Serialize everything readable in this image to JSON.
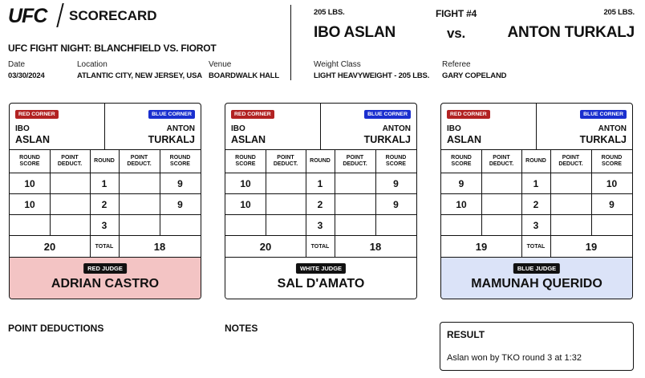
{
  "header": {
    "brand": "UFC",
    "doc_title": "SCORECARD",
    "event": "UFC FIGHT NIGHT: BLANCHFIELD VS. FIOROT",
    "date_label": "Date",
    "date": "03/30/2024",
    "location_label": "Location",
    "location": "ATLANTIC CITY, NEW JERSEY, USA",
    "venue_label": "Venue",
    "venue": "BOARDWALK HALL"
  },
  "fight": {
    "fight_number": "FIGHT #4",
    "vs": "vs.",
    "red_fighter": {
      "weight": "205 LBS.",
      "name": "IBO ASLAN"
    },
    "blue_fighter": {
      "weight": "205 LBS.",
      "name": "ANTON TURKALJ"
    },
    "weight_class_label": "Weight Class",
    "weight_class": "LIGHT HEAVYWEIGHT - 205 LBS.",
    "referee_label": "Referee",
    "referee": "GARY COPELAND"
  },
  "labels": {
    "red_corner": "RED CORNER",
    "blue_corner": "BLUE CORNER",
    "round_score": "ROUND SCORE",
    "point_deduct": "POINT DEDUCT.",
    "round": "ROUND",
    "total": "TOTAL",
    "point_deductions_section": "POINT DEDUCTIONS",
    "notes_section": "NOTES",
    "result_section": "RESULT"
  },
  "cards": [
    {
      "red_first": "IBO",
      "red_last": "ASLAN",
      "blue_first": "ANTON",
      "blue_last": "TURKALJ",
      "rounds": [
        {
          "round": "1",
          "red_score": "10",
          "red_deduct": "",
          "blue_deduct": "",
          "blue_score": "9"
        },
        {
          "round": "2",
          "red_score": "10",
          "red_deduct": "",
          "blue_deduct": "",
          "blue_score": "9"
        },
        {
          "round": "3",
          "red_score": "",
          "red_deduct": "",
          "blue_deduct": "",
          "blue_score": ""
        }
      ],
      "red_total": "20",
      "blue_total": "18",
      "judge_label": "RED JUDGE",
      "judge_name": "ADRIAN CASTRO",
      "judge_bg": "#f3c4c4"
    },
    {
      "red_first": "IBO",
      "red_last": "ASLAN",
      "blue_first": "ANTON",
      "blue_last": "TURKALJ",
      "rounds": [
        {
          "round": "1",
          "red_score": "10",
          "red_deduct": "",
          "blue_deduct": "",
          "blue_score": "9"
        },
        {
          "round": "2",
          "red_score": "10",
          "red_deduct": "",
          "blue_deduct": "",
          "blue_score": "9"
        },
        {
          "round": "3",
          "red_score": "",
          "red_deduct": "",
          "blue_deduct": "",
          "blue_score": ""
        }
      ],
      "red_total": "20",
      "blue_total": "18",
      "judge_label": "WHITE JUDGE",
      "judge_name": "SAL D'AMATO",
      "judge_bg": "#ffffff"
    },
    {
      "red_first": "IBO",
      "red_last": "ASLAN",
      "blue_first": "ANTON",
      "blue_last": "TURKALJ",
      "rounds": [
        {
          "round": "1",
          "red_score": "9",
          "red_deduct": "",
          "blue_deduct": "",
          "blue_score": "10"
        },
        {
          "round": "2",
          "red_score": "10",
          "red_deduct": "",
          "blue_deduct": "",
          "blue_score": "9"
        },
        {
          "round": "3",
          "red_score": "",
          "red_deduct": "",
          "blue_deduct": "",
          "blue_score": ""
        }
      ],
      "red_total": "19",
      "blue_total": "19",
      "judge_label": "BLUE JUDGE",
      "judge_name": "MAMUNAH QUERIDO",
      "judge_bg": "#dbe3f8"
    }
  ],
  "result": {
    "text": "Aslan won by TKO round 3 at 1:32"
  },
  "colors": {
    "red_corner": "#b22222",
    "blue_corner": "#1a2fcf"
  }
}
